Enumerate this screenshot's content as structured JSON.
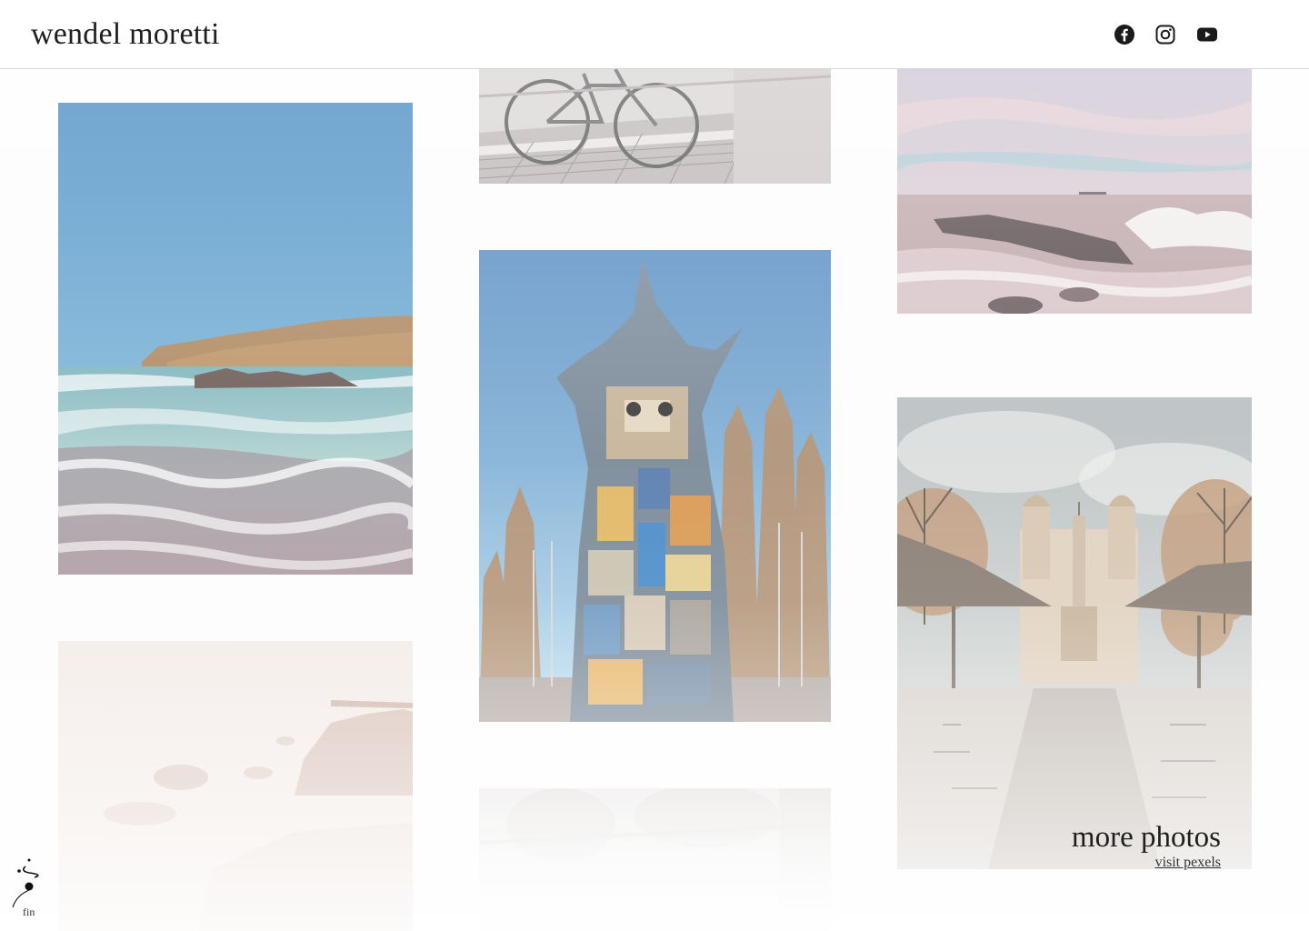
{
  "header": {
    "brand": "wendel moretti",
    "social": [
      {
        "name": "facebook-icon"
      },
      {
        "name": "instagram-icon"
      },
      {
        "name": "youtube-icon"
      }
    ]
  },
  "gallery": {
    "more_title": "more photos",
    "more_link": "visit pexels"
  },
  "badge": {
    "label": "fin"
  },
  "colors": {
    "text": "#1f1f1f",
    "background": "#fdfdfd",
    "divider": "#d8d8d8"
  }
}
